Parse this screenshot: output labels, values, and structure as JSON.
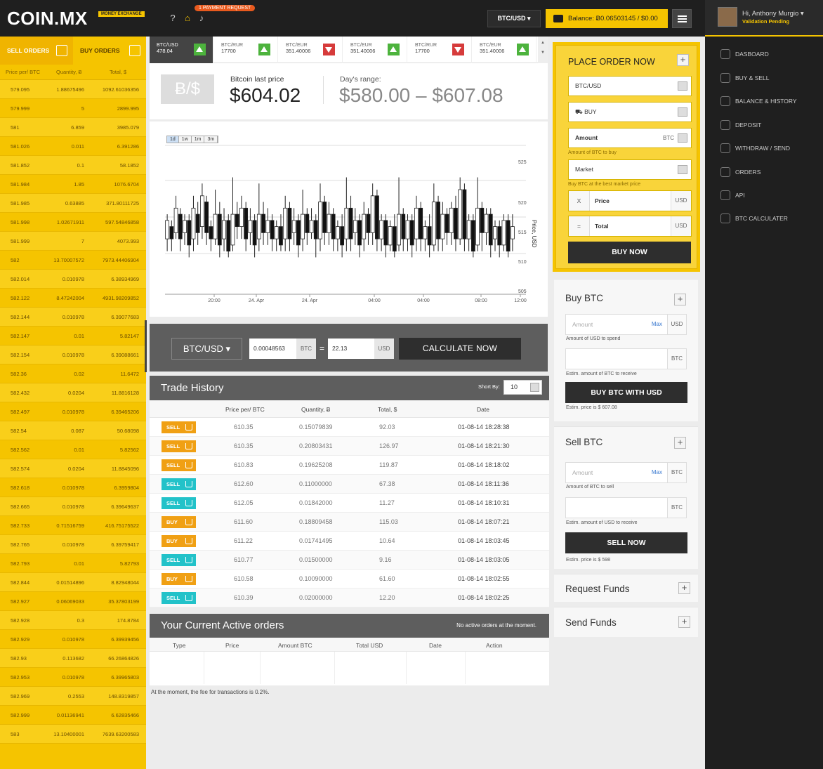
{
  "header": {
    "logo": "COIN.MX",
    "logo_sub": "MONEY EXCHANGE",
    "payment_badge": "1 PAYMENT REQUEST",
    "pair_selector": "BTC/USD ▾",
    "balance": "Balance: Ƀ0.06503145 / $0.00",
    "user_greeting": "Hi, Anthony Murgio ▾",
    "user_status": "Validation Pending"
  },
  "nav": {
    "items": [
      {
        "label": "DASBOARD",
        "icon": "dashboard-icon"
      },
      {
        "label": "BUY & SELL",
        "icon": "dollar-icon"
      },
      {
        "label": "BALANCE & HISTORY",
        "icon": "warning-icon"
      },
      {
        "label": "DEPOSIT",
        "icon": "piggy-bank-icon"
      },
      {
        "label": "WITHDRAW / SEND",
        "icon": "transfer-icon"
      },
      {
        "label": "ORDERS",
        "icon": "orders-icon"
      },
      {
        "label": "API",
        "icon": "api-icon"
      },
      {
        "label": "BTC CALCULATER",
        "icon": "calculator-icon"
      }
    ]
  },
  "orderbook": {
    "tab_sell": "SELL ORDERS",
    "tab_buy": "BUY ORDERS",
    "col_price": "Price per/ BTC",
    "col_qty": "Quantity, Ƀ",
    "col_total": "Total, $",
    "rows": [
      [
        "579.095",
        "1.88675496",
        "1092.61036356"
      ],
      [
        "579.999",
        "5",
        "2899.995"
      ],
      [
        "581",
        "6.859",
        "3985.079"
      ],
      [
        "581.026",
        "0.011",
        "6.391286"
      ],
      [
        "581.852",
        "0.1",
        "58.1852"
      ],
      [
        "581.984",
        "1.85",
        "1076.6704"
      ],
      [
        "581.985",
        "0.63885",
        "371.80111725"
      ],
      [
        "581.998",
        "1.02671911",
        "597.54846858"
      ],
      [
        "581.999",
        "7",
        "4073.993"
      ],
      [
        "582",
        "13.70007572",
        "7973.44406904"
      ],
      [
        "582.014",
        "0.010978",
        "6.38934969"
      ],
      [
        "582.122",
        "8.47242004",
        "4931.98209852"
      ],
      [
        "582.144",
        "0.010978",
        "6.39077683"
      ],
      [
        "582.147",
        "0.01",
        "5.82147"
      ],
      [
        "582.154",
        "0.010978",
        "6.39088661"
      ],
      [
        "582.36",
        "0.02",
        "11.6472"
      ],
      [
        "582.432",
        "0.0204",
        "11.8816128"
      ],
      [
        "582.497",
        "0.010978",
        "6.39465206"
      ],
      [
        "582.54",
        "0.087",
        "50.68098"
      ],
      [
        "582.562",
        "0.01",
        "5.82562"
      ],
      [
        "582.574",
        "0.0204",
        "11.8845096"
      ],
      [
        "582.618",
        "0.010978",
        "6.3959804"
      ],
      [
        "582.665",
        "0.010978",
        "6.39649637"
      ],
      [
        "582.733",
        "0.71516759",
        "416.75175522"
      ],
      [
        "582.765",
        "0.010978",
        "6.39759417"
      ],
      [
        "582.793",
        "0.01",
        "5.82793"
      ],
      [
        "582.844",
        "0.01514896",
        "8.82948044"
      ],
      [
        "582.927",
        "0.06069033",
        "35.37803199"
      ],
      [
        "582.928",
        "0.3",
        "174.8784"
      ],
      [
        "582.929",
        "0.010978",
        "6.39939456"
      ],
      [
        "582.93",
        "0.113682",
        "66.26864826"
      ],
      [
        "582.953",
        "0.010978",
        "6.39965803"
      ],
      [
        "582.969",
        "0.2553",
        "148.8319857"
      ],
      [
        "582.999",
        "0.01136941",
        "6.62835466"
      ],
      [
        "583",
        "13.10400001",
        "7639.63200583"
      ]
    ]
  },
  "ticker": [
    {
      "pair": "BTC/USD",
      "value": "478.04",
      "dir": "up"
    },
    {
      "pair": "BTC/RUR",
      "value": "17700",
      "dir": "up"
    },
    {
      "pair": "BTC/EUR",
      "value": "351.40006",
      "dir": "down"
    },
    {
      "pair": "BTC/EUR",
      "value": "351.40006",
      "dir": "up"
    },
    {
      "pair": "BTC/RUR",
      "value": "17700",
      "dir": "down"
    },
    {
      "pair": "BTC/EUR",
      "value": "351.40006",
      "dir": "up"
    }
  ],
  "price": {
    "symbol": "Ƀ/$",
    "last_label": "Bitcoin last price",
    "last_value": "$604.02",
    "range_label": "Day's range:",
    "range_value": "$580.00 – $607.08"
  },
  "chart": {
    "ranges": [
      "1d",
      "1w",
      "1m",
      "3m"
    ],
    "active_range": "1d",
    "ylabel": "Price, USD",
    "y_ticks": [
      "525",
      "520",
      "515",
      "510",
      "505"
    ],
    "x_ticks": [
      "20:00",
      "24. Apr",
      "24. Apr",
      "04:00",
      "04:00",
      "08:00",
      "12:00"
    ]
  },
  "chart_data": {
    "type": "candlestick",
    "ylabel": "Price, USD",
    "ylim": [
      505,
      526
    ],
    "x_ticks": [
      "20:00",
      "24. Apr",
      "24. Apr",
      "04:00",
      "04:00",
      "08:00",
      "12:00"
    ],
    "candles": [
      [
        514,
        517,
        512,
        518,
        "u"
      ],
      [
        516,
        514,
        512,
        517,
        "d"
      ],
      [
        515,
        519,
        514,
        521,
        "u"
      ],
      [
        518,
        514,
        512,
        519,
        "d"
      ],
      [
        515,
        517,
        513,
        518,
        "u"
      ],
      [
        517,
        513,
        511,
        518,
        "d"
      ],
      [
        514,
        519,
        512,
        521,
        "u"
      ],
      [
        518,
        515,
        513,
        520,
        "d"
      ],
      [
        516,
        521,
        514,
        523,
        "u"
      ],
      [
        520,
        515,
        513,
        521,
        "d"
      ],
      [
        516,
        514,
        512,
        517,
        "d"
      ],
      [
        514,
        518,
        513,
        522,
        "u"
      ],
      [
        518,
        513,
        511,
        520,
        "d"
      ],
      [
        514,
        517,
        512,
        519,
        "u"
      ],
      [
        517,
        512,
        511,
        518,
        "d"
      ],
      [
        513,
        518,
        512,
        524,
        "u"
      ],
      [
        518,
        516,
        514,
        520,
        "d"
      ],
      [
        516,
        519,
        514,
        521,
        "u"
      ],
      [
        519,
        514,
        512,
        520,
        "d"
      ],
      [
        515,
        517,
        513,
        519,
        "u"
      ],
      [
        517,
        513,
        511,
        518,
        "d"
      ],
      [
        514,
        518,
        512,
        523,
        "u"
      ],
      [
        518,
        515,
        513,
        520,
        "d"
      ],
      [
        515,
        517,
        513,
        519,
        "u"
      ],
      [
        517,
        514,
        512,
        518,
        "d"
      ],
      [
        514,
        516,
        512,
        517,
        "u"
      ],
      [
        516,
        513,
        512,
        518,
        "d"
      ],
      [
        514,
        519,
        512,
        521,
        "u"
      ],
      [
        519,
        514,
        512,
        520,
        "d"
      ],
      [
        515,
        517,
        513,
        519,
        "u"
      ],
      [
        517,
        513,
        511,
        518,
        "d"
      ],
      [
        514,
        518,
        512,
        522,
        "u"
      ],
      [
        518,
        515,
        513,
        519,
        "d"
      ],
      [
        515,
        517,
        514,
        519,
        "u"
      ],
      [
        517,
        514,
        511,
        518,
        "d"
      ],
      [
        514,
        520,
        512,
        523,
        "u"
      ],
      [
        520,
        515,
        513,
        521,
        "d"
      ],
      [
        515,
        518,
        513,
        520,
        "u"
      ],
      [
        518,
        514,
        512,
        519,
        "d"
      ],
      [
        514,
        516,
        512,
        517,
        "u"
      ],
      [
        516,
        513,
        511,
        518,
        "d"
      ],
      [
        514,
        519,
        512,
        524,
        "u"
      ],
      [
        519,
        514,
        512,
        521,
        "d"
      ],
      [
        515,
        517,
        513,
        519,
        "u"
      ],
      [
        517,
        513,
        511,
        518,
        "d"
      ],
      [
        514,
        518,
        512,
        520,
        "u"
      ],
      [
        518,
        515,
        513,
        519,
        "d"
      ],
      [
        515,
        521,
        513,
        523,
        "u"
      ],
      [
        521,
        514,
        512,
        522,
        "d"
      ],
      [
        514,
        517,
        512,
        518,
        "u"
      ],
      [
        517,
        513,
        511,
        518,
        "d"
      ],
      [
        513,
        516,
        512,
        517,
        "u"
      ],
      [
        516,
        512,
        511,
        518,
        "d"
      ],
      [
        513,
        518,
        512,
        524,
        "u"
      ],
      [
        518,
        514,
        512,
        519,
        "d"
      ],
      [
        514,
        517,
        512,
        518,
        "u"
      ],
      [
        517,
        513,
        511,
        518,
        "d"
      ],
      [
        514,
        519,
        512,
        521,
        "u"
      ],
      [
        519,
        514,
        512,
        520,
        "d"
      ],
      [
        514,
        516,
        512,
        517,
        "u"
      ],
      [
        516,
        513,
        511,
        518,
        "d"
      ],
      [
        513,
        520,
        512,
        523,
        "u"
      ],
      [
        520,
        514,
        512,
        521,
        "d"
      ],
      [
        514,
        518,
        512,
        520,
        "u"
      ],
      [
        518,
        515,
        513,
        519,
        "d"
      ],
      [
        515,
        519,
        513,
        520,
        "u"
      ],
      [
        519,
        514,
        512,
        521,
        "d"
      ],
      [
        514,
        522,
        513,
        524,
        "u"
      ],
      [
        522,
        514,
        512,
        523,
        "d"
      ],
      [
        514,
        517,
        512,
        518,
        "u"
      ],
      [
        517,
        512,
        511,
        518,
        "d"
      ],
      [
        513,
        519,
        512,
        524,
        "u"
      ],
      [
        519,
        515,
        512,
        520,
        "d"
      ],
      [
        515,
        518,
        513,
        519,
        "u"
      ],
      [
        518,
        513,
        511,
        519,
        "d"
      ],
      [
        514,
        516,
        512,
        517,
        "u"
      ],
      [
        516,
        513,
        511,
        517,
        "d"
      ],
      [
        513,
        517,
        512,
        518,
        "u"
      ],
      [
        517,
        512,
        511,
        518,
        "d"
      ],
      [
        514,
        516,
        512,
        518,
        "u"
      ]
    ]
  },
  "calc": {
    "pair": "BTC/USD ▾",
    "btc_value": "0.00048563",
    "btc_unit": "BTC",
    "eq": "=",
    "usd_value": "22.13",
    "usd_unit": "USD",
    "button": "CALCULATE NOW"
  },
  "trade_history": {
    "title": "Trade History",
    "sort_label": "Short By:",
    "sort_value": "10",
    "cols": [
      "Price per/ BTC",
      "Quantity, Ƀ",
      "Total, $",
      "Date"
    ],
    "rows": [
      {
        "type": "SELL",
        "color": "orange",
        "price": "610.35",
        "qty": "0.15079839",
        "total": "92.03",
        "date": "01-08-14 18:28:38"
      },
      {
        "type": "SELL",
        "color": "orange",
        "price": "610.35",
        "qty": "0.20803431",
        "total": "126.97",
        "date": "01-08-14 18:21:30"
      },
      {
        "type": "SELL",
        "color": "orange",
        "price": "610.83",
        "qty": "0.19625208",
        "total": "119.87",
        "date": "01-08-14 18:18:02"
      },
      {
        "type": "SELL",
        "color": "teal",
        "price": "612.60",
        "qty": "0.11000000",
        "total": "67.38",
        "date": "01-08-14 18:11:36"
      },
      {
        "type": "SELL",
        "color": "teal",
        "price": "612.05",
        "qty": "0.01842000",
        "total": "11.27",
        "date": "01-08-14 18:10:31"
      },
      {
        "type": "BUY",
        "color": "orange",
        "price": "611.60",
        "qty": "0.18809458",
        "total": "115.03",
        "date": "01-08-14 18:07:21"
      },
      {
        "type": "BUY",
        "color": "orange",
        "price": "611.22",
        "qty": "0.01741495",
        "total": "10.64",
        "date": "01-08-14 18:03:45"
      },
      {
        "type": "SELL",
        "color": "teal",
        "price": "610.77",
        "qty": "0.01500000",
        "total": "9.16",
        "date": "01-08-14 18:03:05"
      },
      {
        "type": "BUY",
        "color": "orange",
        "price": "610.58",
        "qty": "0.10090000",
        "total": "61.60",
        "date": "01-08-14 18:02:55"
      },
      {
        "type": "SELL",
        "color": "teal",
        "price": "610.39",
        "qty": "0.02000000",
        "total": "12.20",
        "date": "01-08-14 18:02:25"
      }
    ]
  },
  "active_orders": {
    "title": "Your Current Active orders",
    "note": "No active orders at the moment.",
    "cols": [
      "Type",
      "Price",
      "Amount BTC",
      "Total USD",
      "Date",
      "Action"
    ]
  },
  "fee_note": "At the moment, the fee for transactions is 0.2%.",
  "place_order": {
    "title": "PLACE ORDER NOW",
    "plus": "+",
    "pair": "BTC/USD",
    "side": "BUY",
    "amount_label": "Amount",
    "amount_unit": "BTC",
    "amount_hint": "Amount of BTC to buy",
    "type": "Market",
    "type_hint": "Buy BTC at the best market price",
    "price_prefix": "X",
    "price_label": "Price",
    "price_unit": "USD",
    "total_prefix": "=",
    "total_label": "Total",
    "total_unit": "USD",
    "button": "BUY NOW"
  },
  "buy_btc": {
    "title": "Buy BTC",
    "amount_placeholder": "Amount",
    "max": "Max",
    "unit1": "USD",
    "hint1": "Amount of USD to spend",
    "unit2": "BTC",
    "hint2": "Estim. amount of BTC to receive",
    "button": "BUY BTC WITH USD",
    "estim": "Estim. price is $ 607.08"
  },
  "sell_btc": {
    "title": "Sell BTC",
    "amount_placeholder": "Amount",
    "max": "Max",
    "unit1": "BTC",
    "hint1": "Amount of BTC to sell",
    "unit2": "BTC",
    "hint2": "Estim. amount of USD to receive",
    "button": "SELL NOW",
    "estim": "Estim. price is $ 598"
  },
  "request_funds": {
    "title": "Request Funds"
  },
  "send_funds": {
    "title": "Send Funds"
  },
  "colors": {
    "accent": "#f5c400",
    "dark": "#1f1f1f",
    "up": "#4db33d",
    "down": "#d63b3b",
    "teal": "#22c2c9",
    "orange": "#f0a014"
  }
}
